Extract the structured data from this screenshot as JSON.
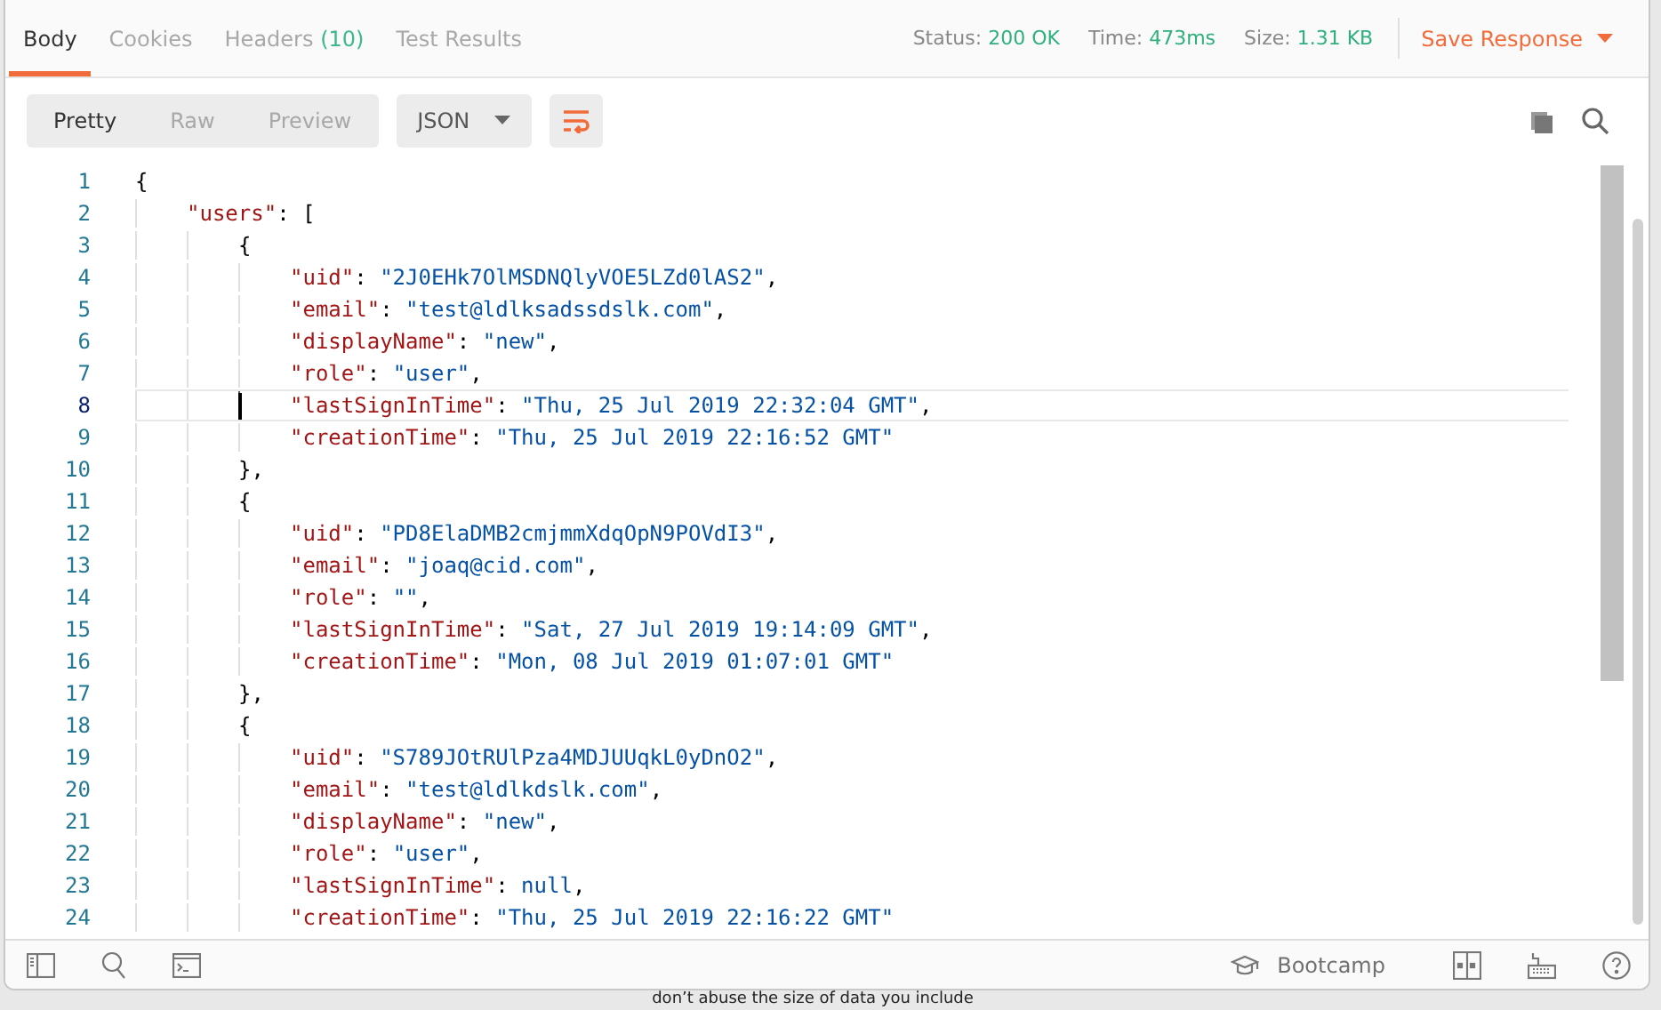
{
  "response_tabs": [
    {
      "label": "Body",
      "selected": true
    },
    {
      "label": "Cookies",
      "selected": false
    },
    {
      "label": "Headers",
      "count": "(10)",
      "selected": false
    },
    {
      "label": "Test Results",
      "selected": false
    }
  ],
  "meta": [
    {
      "label": "Status:",
      "value": "200 OK"
    },
    {
      "label": "Time:",
      "value": "473ms"
    },
    {
      "label": "Size:",
      "value": "1.31 KB"
    }
  ],
  "save_response": "Save Response",
  "view_modes": [
    {
      "label": "Pretty",
      "selected": true
    },
    {
      "label": "Raw",
      "selected": false
    },
    {
      "label": "Preview",
      "selected": false
    }
  ],
  "format": "JSON",
  "wrap_lines": true,
  "code": [
    {
      "number": "1",
      "tokens": [
        {
          "kind": "punct",
          "text": "{"
        }
      ],
      "children": [
        {
          "number": "2",
          "tokens": [
            {
              "kind": "key",
              "text": "\"users\""
            },
            {
              "kind": "punct",
              "text": ": ["
            }
          ],
          "children": [
            {
              "number": "3",
              "tokens": [
                {
                  "kind": "punct",
                  "text": "{"
                }
              ],
              "children": [
                {
                  "number": "4",
                  "tokens": [
                    {
                      "kind": "key",
                      "text": "\"uid\""
                    },
                    {
                      "kind": "punct",
                      "text": ": "
                    },
                    {
                      "kind": "string",
                      "text": "\"2J0EHk7OlMSDNQlyVOE5LZd0lAS2\""
                    },
                    {
                      "kind": "punct",
                      "text": ","
                    }
                  ]
                },
                {
                  "number": "5",
                  "tokens": [
                    {
                      "kind": "key",
                      "text": "\"email\""
                    },
                    {
                      "kind": "punct",
                      "text": ": "
                    },
                    {
                      "kind": "string",
                      "text": "\"test@ldlksadssdslk.com\""
                    },
                    {
                      "kind": "punct",
                      "text": ","
                    }
                  ]
                },
                {
                  "number": "6",
                  "tokens": [
                    {
                      "kind": "key",
                      "text": "\"displayName\""
                    },
                    {
                      "kind": "punct",
                      "text": ": "
                    },
                    {
                      "kind": "string",
                      "text": "\"new\""
                    },
                    {
                      "kind": "punct",
                      "text": ","
                    }
                  ]
                },
                {
                  "number": "7",
                  "tokens": [
                    {
                      "kind": "key",
                      "text": "\"role\""
                    },
                    {
                      "kind": "punct",
                      "text": ": "
                    },
                    {
                      "kind": "string",
                      "text": "\"user\""
                    },
                    {
                      "kind": "punct",
                      "text": ","
                    }
                  ]
                },
                {
                  "number": "8",
                  "current": true,
                  "tokens": [
                    {
                      "kind": "key",
                      "text": "\"lastSignInTime\""
                    },
                    {
                      "kind": "punct",
                      "text": ": "
                    },
                    {
                      "kind": "string",
                      "text": "\"Thu, 25 Jul 2019 22:32:04 GMT\""
                    },
                    {
                      "kind": "punct",
                      "text": ","
                    }
                  ]
                },
                {
                  "number": "9",
                  "tokens": [
                    {
                      "kind": "key",
                      "text": "\"creationTime\""
                    },
                    {
                      "kind": "punct",
                      "text": ": "
                    },
                    {
                      "kind": "string",
                      "text": "\"Thu, 25 Jul 2019 22:16:52 GMT\""
                    }
                  ]
                }
              ]
            },
            {
              "number": "10",
              "tokens": [
                {
                  "kind": "punct",
                  "text": "},"
                }
              ]
            },
            {
              "number": "11",
              "tokens": [
                {
                  "kind": "punct",
                  "text": "{"
                }
              ],
              "children": [
                {
                  "number": "12",
                  "tokens": [
                    {
                      "kind": "key",
                      "text": "\"uid\""
                    },
                    {
                      "kind": "punct",
                      "text": ": "
                    },
                    {
                      "kind": "string",
                      "text": "\"PD8ElaDMB2cmjmmXdqOpN9POVdI3\""
                    },
                    {
                      "kind": "punct",
                      "text": ","
                    }
                  ]
                },
                {
                  "number": "13",
                  "tokens": [
                    {
                      "kind": "key",
                      "text": "\"email\""
                    },
                    {
                      "kind": "punct",
                      "text": ": "
                    },
                    {
                      "kind": "string",
                      "text": "\"joaq@cid.com\""
                    },
                    {
                      "kind": "punct",
                      "text": ","
                    }
                  ]
                },
                {
                  "number": "14",
                  "tokens": [
                    {
                      "kind": "key",
                      "text": "\"role\""
                    },
                    {
                      "kind": "punct",
                      "text": ": "
                    },
                    {
                      "kind": "string",
                      "text": "\"\""
                    },
                    {
                      "kind": "punct",
                      "text": ","
                    }
                  ]
                },
                {
                  "number": "15",
                  "tokens": [
                    {
                      "kind": "key",
                      "text": "\"lastSignInTime\""
                    },
                    {
                      "kind": "punct",
                      "text": ": "
                    },
                    {
                      "kind": "string",
                      "text": "\"Sat, 27 Jul 2019 19:14:09 GMT\""
                    },
                    {
                      "kind": "punct",
                      "text": ","
                    }
                  ]
                },
                {
                  "number": "16",
                  "tokens": [
                    {
                      "kind": "key",
                      "text": "\"creationTime\""
                    },
                    {
                      "kind": "punct",
                      "text": ": "
                    },
                    {
                      "kind": "string",
                      "text": "\"Mon, 08 Jul 2019 01:07:01 GMT\""
                    }
                  ]
                }
              ]
            },
            {
              "number": "17",
              "tokens": [
                {
                  "kind": "punct",
                  "text": "},"
                }
              ]
            },
            {
              "number": "18",
              "tokens": [
                {
                  "kind": "punct",
                  "text": "{"
                }
              ],
              "children": [
                {
                  "number": "19",
                  "tokens": [
                    {
                      "kind": "key",
                      "text": "\"uid\""
                    },
                    {
                      "kind": "punct",
                      "text": ": "
                    },
                    {
                      "kind": "string",
                      "text": "\"S789JOtRUlPza4MDJUUqkL0yDnO2\""
                    },
                    {
                      "kind": "punct",
                      "text": ","
                    }
                  ]
                },
                {
                  "number": "20",
                  "tokens": [
                    {
                      "kind": "key",
                      "text": "\"email\""
                    },
                    {
                      "kind": "punct",
                      "text": ": "
                    },
                    {
                      "kind": "string",
                      "text": "\"test@ldlkdslk.com\""
                    },
                    {
                      "kind": "punct",
                      "text": ","
                    }
                  ]
                },
                {
                  "number": "21",
                  "tokens": [
                    {
                      "kind": "key",
                      "text": "\"displayName\""
                    },
                    {
                      "kind": "punct",
                      "text": ": "
                    },
                    {
                      "kind": "string",
                      "text": "\"new\""
                    },
                    {
                      "kind": "punct",
                      "text": ","
                    }
                  ]
                },
                {
                  "number": "22",
                  "tokens": [
                    {
                      "kind": "key",
                      "text": "\"role\""
                    },
                    {
                      "kind": "punct",
                      "text": ": "
                    },
                    {
                      "kind": "string",
                      "text": "\"user\""
                    },
                    {
                      "kind": "punct",
                      "text": ","
                    }
                  ]
                },
                {
                  "number": "23",
                  "tokens": [
                    {
                      "kind": "key",
                      "text": "\"lastSignInTime\""
                    },
                    {
                      "kind": "punct",
                      "text": ": "
                    },
                    {
                      "kind": "null",
                      "text": "null"
                    },
                    {
                      "kind": "punct",
                      "text": ","
                    }
                  ]
                },
                {
                  "number": "24",
                  "tokens": [
                    {
                      "kind": "key",
                      "text": "\"creationTime\""
                    },
                    {
                      "kind": "punct",
                      "text": ": "
                    },
                    {
                      "kind": "string",
                      "text": "\"Thu, 25 Jul 2019 22:16:22 GMT\""
                    }
                  ]
                }
              ]
            }
          ]
        }
      ]
    }
  ],
  "footer": {
    "bootcamp": "Bootcamp"
  },
  "background_text": "don’t abuse the size of data you include"
}
